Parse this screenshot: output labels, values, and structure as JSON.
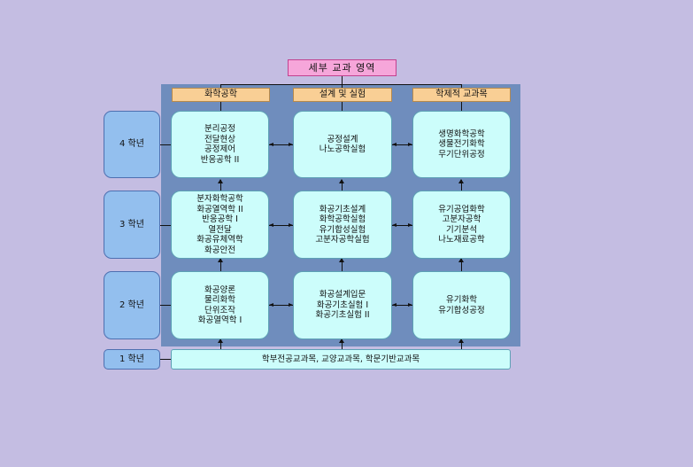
{
  "title": "세부 교과 영역",
  "columns": [
    "화학공학",
    "설계 및 실험",
    "학제적 교과목"
  ],
  "years": [
    "4 학년",
    "3 학년",
    "2 학년",
    "1 학년"
  ],
  "rows": [
    [
      [
        "분리공정",
        "전달현상",
        "공정제어",
        "반응공학 II"
      ],
      [
        "공정설계",
        "나노공학실험"
      ],
      [
        "생명화학공학",
        "생물전기화학",
        "무기단위공정"
      ]
    ],
    [
      [
        "분자화학공학",
        "화공열역학 II",
        "반응공학 I",
        "열전달",
        "화공유체역학",
        "화공안전"
      ],
      [
        "화공기초설계",
        "화학공학실험",
        "유기합성실험",
        "고분자공학실험"
      ],
      [
        "유기공업화학",
        "고분자공학",
        "기기분석",
        "나노재료공학"
      ]
    ],
    [
      [
        "화공양론",
        "물리화학",
        "단위조작",
        "화공열역학 I"
      ],
      [
        "화공설계입문",
        "화공기초실험 I",
        "화공기초실험 II"
      ],
      [
        "유기화학",
        "유기합성공정"
      ]
    ]
  ],
  "base": "학부전공교과목, 교양교과목, 학문기반교과목",
  "colors": {
    "background": "#c4bde2",
    "panel": "#6f8dbd",
    "title": "#f6a6da",
    "header": "#f9cf95",
    "year": "#93bfee",
    "course": "#ccfdfb"
  }
}
